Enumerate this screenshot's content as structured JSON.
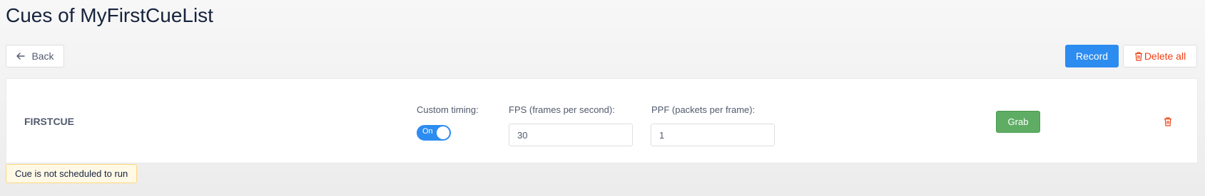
{
  "header": {
    "title": "Cues of MyFirstCueList"
  },
  "toolbar": {
    "back_label": "Back",
    "back_icon": "arrow-left-icon",
    "record_label": "Record",
    "delete_all_label": "Delete all",
    "delete_all_icon": "trash-icon"
  },
  "cue": {
    "name": "FIRSTCUE",
    "custom_timing_label": "Custom timing:",
    "custom_timing_state": "On",
    "fps_label": "FPS (frames per second):",
    "fps_value": "30",
    "ppf_label": "PPF (packets per frame):",
    "ppf_value": "1",
    "grab_label": "Grab",
    "delete_icon": "trash-icon"
  },
  "status": {
    "text": "Cue is not scheduled to run"
  },
  "colors": {
    "primary": "#2d8cf0",
    "danger": "#ed4014",
    "success": "#5fad65",
    "warning_bg": "#fff9e6",
    "warning_border": "#ffd77a",
    "title": "#17233d"
  }
}
